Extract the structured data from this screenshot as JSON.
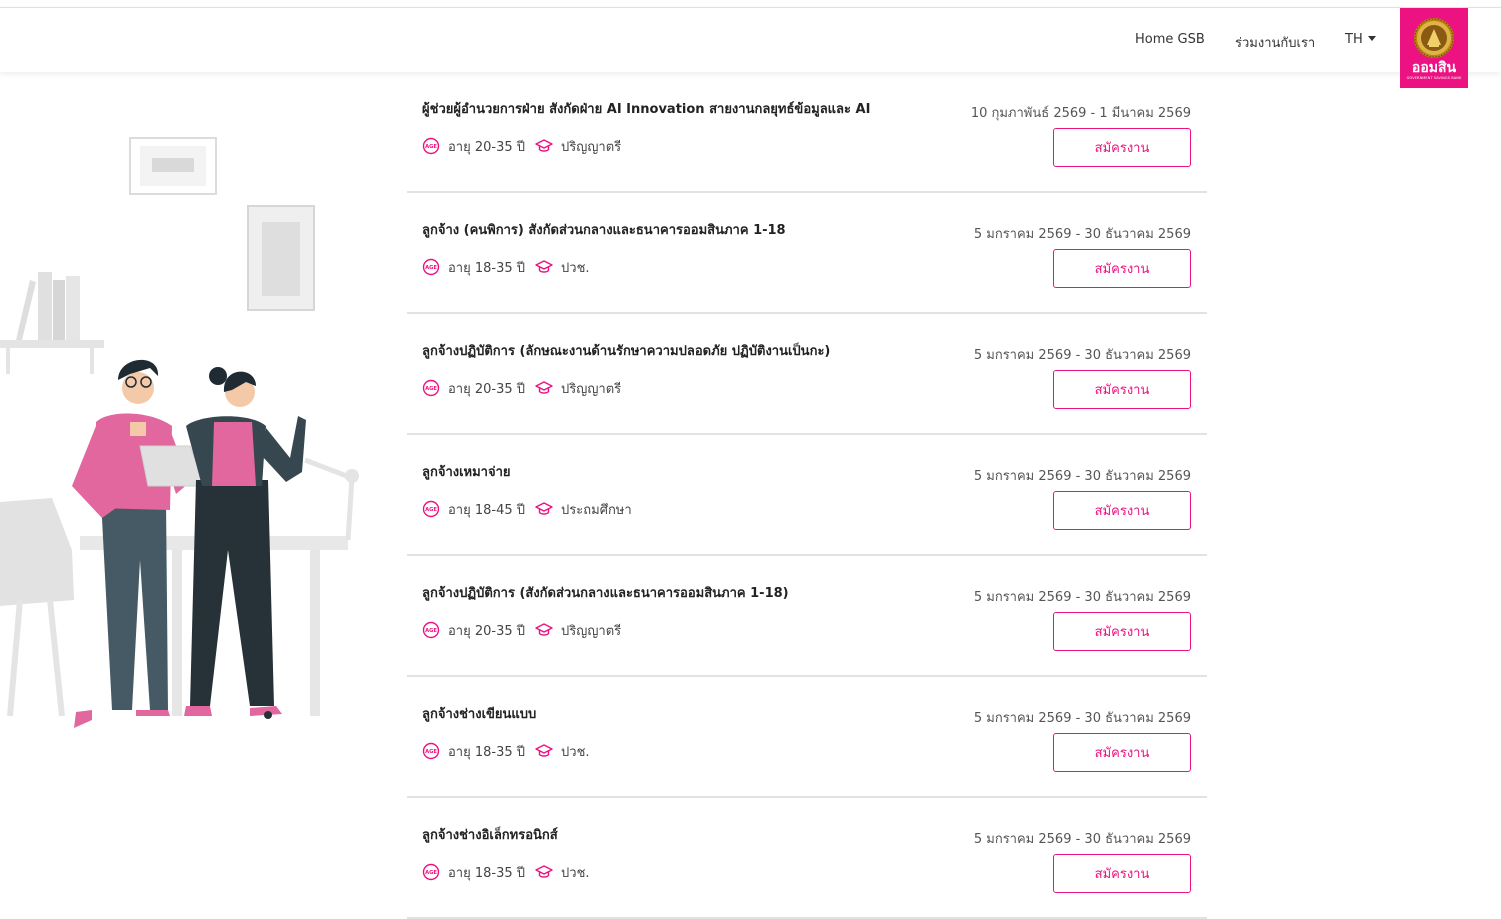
{
  "nav": {
    "home_label": "Home GSB",
    "join_label": "ร่วมงานกับเรา",
    "lang_label": "TH"
  },
  "logo": {
    "text": "ออมสิน",
    "subtext": "GOVERNMENT SAVINGS BANK"
  },
  "colors": {
    "brand": "#ec1282",
    "divider": "#e2e2e2"
  },
  "icons": {
    "age": "age-icon",
    "education": "graduation-cap-icon"
  },
  "jobs": [
    {
      "title": "ผู้ช่วยผู้อำนวยการฝ่าย สังกัดฝ่าย AI Innovation สายงานกลยุทธ์ข้อมูลและ AI",
      "age": "อายุ 20-35 ปี",
      "education": "ปริญญาตรี",
      "date": "10 กุมภาพันธ์ 2569 - 1 มีนาคม 2569",
      "apply_label": "สมัครงาน"
    },
    {
      "title": "ลูกจ้าง (คนพิการ) สังกัดส่วนกลางและธนาคารออมสินภาค 1-18",
      "age": "อายุ 18-35 ปี",
      "education": "ปวช.",
      "date": "5 มกราคม 2569 - 30 ธันวาคม 2569",
      "apply_label": "สมัครงาน"
    },
    {
      "title": "ลูกจ้างปฏิบัติการ (ลักษณะงานด้านรักษาความปลอดภัย ปฏิบัติงานเป็นกะ)",
      "age": "อายุ 20-35 ปี",
      "education": "ปริญญาตรี",
      "date": "5 มกราคม 2569 - 30 ธันวาคม 2569",
      "apply_label": "สมัครงาน"
    },
    {
      "title": "ลูกจ้างเหมาจ่าย",
      "age": "อายุ 18-45 ปี",
      "education": "ประถมศึกษา",
      "date": "5 มกราคม 2569 - 30 ธันวาคม 2569",
      "apply_label": "สมัครงาน"
    },
    {
      "title": "ลูกจ้างปฏิบัติการ (สังกัดส่วนกลางและธนาคารออมสินภาค 1-18)",
      "age": "อายุ 20-35 ปี",
      "education": "ปริญญาตรี",
      "date": "5 มกราคม 2569 - 30 ธันวาคม 2569",
      "apply_label": "สมัครงาน"
    },
    {
      "title": "ลูกจ้างช่างเขียนแบบ",
      "age": "อายุ 18-35 ปี",
      "education": "ปวช.",
      "date": "5 มกราคม 2569 - 30 ธันวาคม 2569",
      "apply_label": "สมัครงาน"
    },
    {
      "title": "ลูกจ้างช่างอิเล็กทรอนิกส์",
      "age": "อายุ 18-35 ปี",
      "education": "ปวช.",
      "date": "5 มกราคม 2569 - 30 ธันวาคม 2569",
      "apply_label": "สมัครงาน"
    }
  ]
}
